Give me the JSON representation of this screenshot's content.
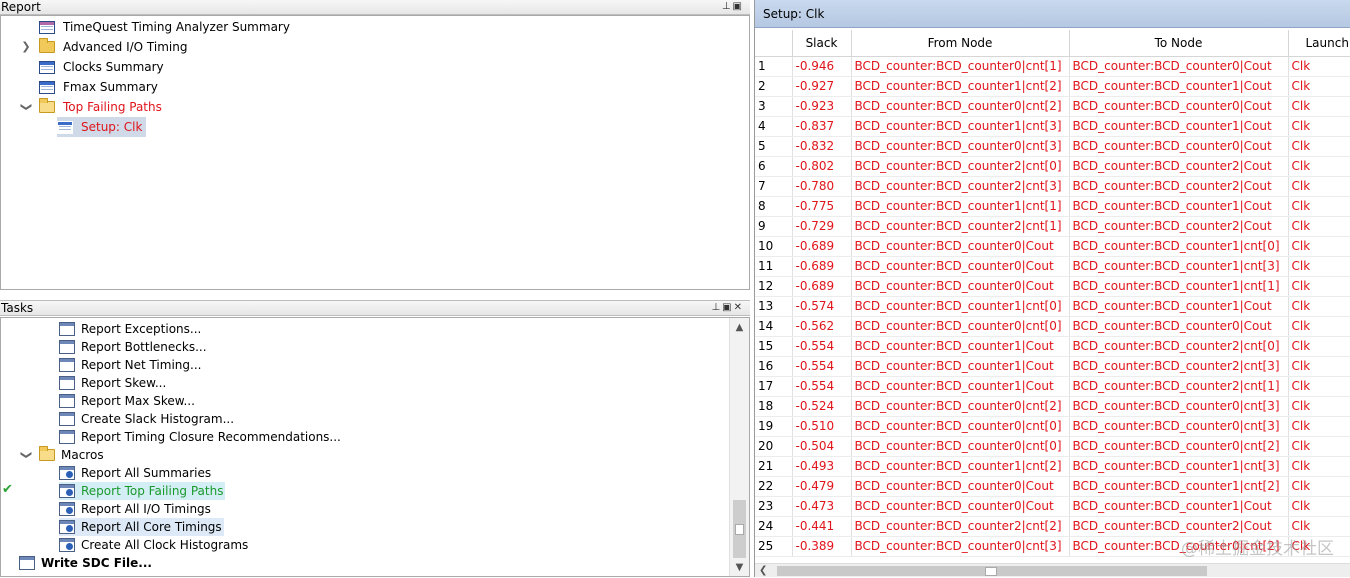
{
  "report_panel": {
    "title": "Report",
    "items": [
      {
        "label": "TimeQuest Timing Analyzer Summary"
      },
      {
        "label": "Advanced I/O Timing"
      },
      {
        "label": "Clocks Summary"
      },
      {
        "label": "Fmax Summary"
      },
      {
        "label": "Top Failing Paths"
      },
      {
        "label": "Setup: Clk"
      }
    ]
  },
  "tasks_panel": {
    "title": "Tasks",
    "items": [
      {
        "label": "Report Exceptions..."
      },
      {
        "label": "Report Bottlenecks..."
      },
      {
        "label": "Report Net Timing..."
      },
      {
        "label": "Report Skew..."
      },
      {
        "label": "Report Max Skew..."
      },
      {
        "label": "Create Slack Histogram..."
      },
      {
        "label": "Report Timing Closure Recommendations..."
      },
      {
        "label": "Macros"
      },
      {
        "label": "Report All Summaries"
      },
      {
        "label": "Report Top Failing Paths"
      },
      {
        "label": "Report All I/O Timings"
      },
      {
        "label": "Report All Core Timings"
      },
      {
        "label": "Create All Clock Histograms"
      },
      {
        "label": "Write SDC File..."
      }
    ]
  },
  "table_panel": {
    "title": "Setup: Clk",
    "columns": [
      "",
      "Slack",
      "From Node",
      "To Node",
      "Launch Clock"
    ],
    "rows": [
      [
        "1",
        "-0.946",
        "BCD_counter:BCD_counter0|cnt[1]",
        "BCD_counter:BCD_counter0|Cout",
        "Clk"
      ],
      [
        "2",
        "-0.927",
        "BCD_counter:BCD_counter1|cnt[2]",
        "BCD_counter:BCD_counter1|Cout",
        "Clk"
      ],
      [
        "3",
        "-0.923",
        "BCD_counter:BCD_counter0|cnt[2]",
        "BCD_counter:BCD_counter0|Cout",
        "Clk"
      ],
      [
        "4",
        "-0.837",
        "BCD_counter:BCD_counter1|cnt[3]",
        "BCD_counter:BCD_counter1|Cout",
        "Clk"
      ],
      [
        "5",
        "-0.832",
        "BCD_counter:BCD_counter0|cnt[3]",
        "BCD_counter:BCD_counter0|Cout",
        "Clk"
      ],
      [
        "6",
        "-0.802",
        "BCD_counter:BCD_counter2|cnt[0]",
        "BCD_counter:BCD_counter2|Cout",
        "Clk"
      ],
      [
        "7",
        "-0.780",
        "BCD_counter:BCD_counter2|cnt[3]",
        "BCD_counter:BCD_counter2|Cout",
        "Clk"
      ],
      [
        "8",
        "-0.775",
        "BCD_counter:BCD_counter1|cnt[1]",
        "BCD_counter:BCD_counter1|Cout",
        "Clk"
      ],
      [
        "9",
        "-0.729",
        "BCD_counter:BCD_counter2|cnt[1]",
        "BCD_counter:BCD_counter2|Cout",
        "Clk"
      ],
      [
        "10",
        "-0.689",
        "BCD_counter:BCD_counter0|Cout",
        "BCD_counter:BCD_counter1|cnt[0]",
        "Clk"
      ],
      [
        "11",
        "-0.689",
        "BCD_counter:BCD_counter0|Cout",
        "BCD_counter:BCD_counter1|cnt[3]",
        "Clk"
      ],
      [
        "12",
        "-0.689",
        "BCD_counter:BCD_counter0|Cout",
        "BCD_counter:BCD_counter1|cnt[1]",
        "Clk"
      ],
      [
        "13",
        "-0.574",
        "BCD_counter:BCD_counter1|cnt[0]",
        "BCD_counter:BCD_counter1|Cout",
        "Clk"
      ],
      [
        "14",
        "-0.562",
        "BCD_counter:BCD_counter0|cnt[0]",
        "BCD_counter:BCD_counter0|Cout",
        "Clk"
      ],
      [
        "15",
        "-0.554",
        "BCD_counter:BCD_counter1|Cout",
        "BCD_counter:BCD_counter2|cnt[0]",
        "Clk"
      ],
      [
        "16",
        "-0.554",
        "BCD_counter:BCD_counter1|Cout",
        "BCD_counter:BCD_counter2|cnt[3]",
        "Clk"
      ],
      [
        "17",
        "-0.554",
        "BCD_counter:BCD_counter1|Cout",
        "BCD_counter:BCD_counter2|cnt[1]",
        "Clk"
      ],
      [
        "18",
        "-0.524",
        "BCD_counter:BCD_counter0|cnt[2]",
        "BCD_counter:BCD_counter0|cnt[3]",
        "Clk"
      ],
      [
        "19",
        "-0.510",
        "BCD_counter:BCD_counter0|cnt[0]",
        "BCD_counter:BCD_counter0|cnt[3]",
        "Clk"
      ],
      [
        "20",
        "-0.504",
        "BCD_counter:BCD_counter0|cnt[0]",
        "BCD_counter:BCD_counter0|cnt[2]",
        "Clk"
      ],
      [
        "21",
        "-0.493",
        "BCD_counter:BCD_counter1|cnt[2]",
        "BCD_counter:BCD_counter1|cnt[3]",
        "Clk"
      ],
      [
        "22",
        "-0.479",
        "BCD_counter:BCD_counter0|Cout",
        "BCD_counter:BCD_counter1|cnt[2]",
        "Clk"
      ],
      [
        "23",
        "-0.473",
        "BCD_counter:BCD_counter0|Cout",
        "BCD_counter:BCD_counter1|Cout",
        "Clk"
      ],
      [
        "24",
        "-0.441",
        "BCD_counter:BCD_counter2|cnt[2]",
        "BCD_counter:BCD_counter2|Cout",
        "Clk"
      ],
      [
        "25",
        "-0.389",
        "BCD_counter:BCD_counter0|cnt[3]",
        "BCD_counter:BCD_counter0|cnt[2]",
        "Clk"
      ]
    ]
  },
  "watermark": "@稀土掘金技术社区",
  "colors": {
    "failing_red": "#e0141b",
    "success_green": "#1a9a2c",
    "title_blue": "#c9d9ee"
  }
}
